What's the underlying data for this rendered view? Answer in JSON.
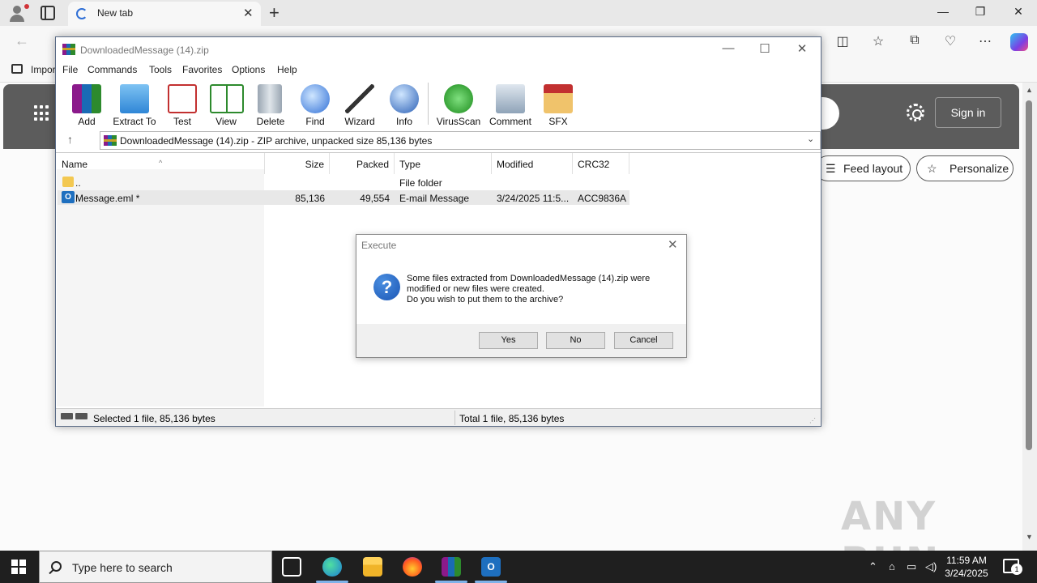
{
  "browser": {
    "tab_title": "New tab",
    "favorites_item": "Impor",
    "signin_label": "Sign in",
    "feed_layout_label": "Feed layout",
    "personalize_label": "Personalize"
  },
  "winrar": {
    "window_title": "DownloadedMessage (14).zip",
    "menu": [
      "File",
      "Commands",
      "Tools",
      "Favorites",
      "Options",
      "Help"
    ],
    "toolbar": [
      "Add",
      "Extract To",
      "Test",
      "View",
      "Delete",
      "Find",
      "Wizard",
      "Info",
      "VirusScan",
      "Comment",
      "SFX"
    ],
    "address": "DownloadedMessage (14).zip - ZIP archive, unpacked size 85,136 bytes",
    "columns": [
      "Name",
      "Size",
      "Packed",
      "Type",
      "Modified",
      "CRC32"
    ],
    "rows": [
      {
        "name": "..",
        "size": "",
        "packed": "",
        "type": "File folder",
        "modified": "",
        "crc": ""
      },
      {
        "name": "Message.eml *",
        "size": "85,136",
        "packed": "49,554",
        "type": "E-mail Message",
        "modified": "3/24/2025 11:5...",
        "crc": "ACC9836A"
      }
    ],
    "status_left": "Selected 1 file, 85,136 bytes",
    "status_right": "Total 1 file, 85,136 bytes"
  },
  "dialog": {
    "title": "Execute",
    "message_line1": "Some files extracted from DownloadedMessage (14).zip were",
    "message_line2": "modified or new files were created.",
    "message_line3": "Do you wish to put them to the archive?",
    "yes_label": "Yes",
    "no_label": "No",
    "cancel_label": "Cancel"
  },
  "taskbar": {
    "search_placeholder": "Type here to search",
    "time": "11:59 AM",
    "date": "3/24/2025",
    "notification_count": "1"
  },
  "watermark": "ANY RUN",
  "colors": {
    "dialog_icon": "#1b56b5",
    "ntp_banner": "#5c5c5c",
    "taskbar_bg": "#1f1f1f"
  }
}
